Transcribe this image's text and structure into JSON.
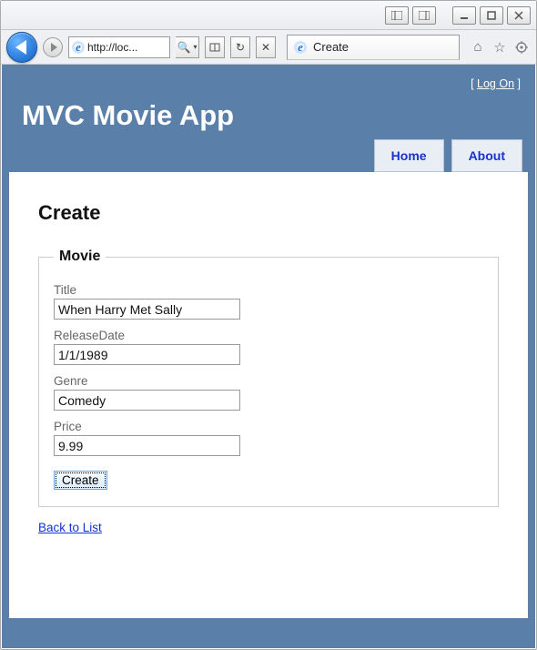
{
  "chrome": {
    "address": "http://loc...",
    "tab_title": "Create"
  },
  "loginbar": {
    "prefix": "[ ",
    "link": "Log On",
    "suffix": " ]"
  },
  "app_title": "MVC Movie App",
  "nav": {
    "home": "Home",
    "about": "About"
  },
  "page": {
    "heading": "Create",
    "legend": "Movie",
    "fields": {
      "title_label": "Title",
      "title_value": "When Harry Met Sally",
      "releasedate_label": "ReleaseDate",
      "releasedate_value": "1/1/1989",
      "genre_label": "Genre",
      "genre_value": "Comedy",
      "price_label": "Price",
      "price_value": "9.99"
    },
    "submit_label": "Create",
    "back_link": "Back to List"
  }
}
